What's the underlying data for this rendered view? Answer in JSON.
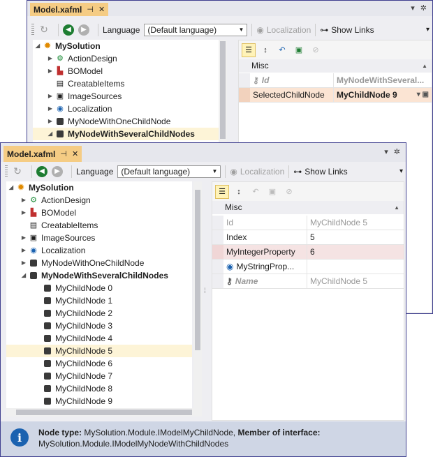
{
  "back_window": {
    "tab_title": "Model.xafml",
    "toolbar": {
      "language_label": "Language",
      "language_value": "(Default language)",
      "localization_label": "Localization",
      "show_links_label": "Show Links"
    },
    "tree": {
      "root": "MySolution",
      "items": [
        "ActionDesign",
        "BOModel",
        "CreatableItems",
        "ImageSources",
        "Localization",
        "MyNodeWithOneChildNode",
        "MyNodeWithSeveralChildNodes"
      ]
    },
    "grid": {
      "category": "Misc",
      "rows": [
        {
          "name": "Id",
          "value": "MyNodeWithSeveral..."
        },
        {
          "name": "SelectedChildNode",
          "value": "MyChildNode 9"
        }
      ]
    }
  },
  "front_window": {
    "tab_title": "Model.xafml",
    "toolbar": {
      "language_label": "Language",
      "language_value": "(Default language)",
      "localization_label": "Localization",
      "show_links_label": "Show Links"
    },
    "tree": {
      "root": "MySolution",
      "items": [
        "ActionDesign",
        "BOModel",
        "CreatableItems",
        "ImageSources",
        "Localization",
        "MyNodeWithOneChildNode",
        "MyNodeWithSeveralChildNodes"
      ],
      "children": [
        "MyChildNode 0",
        "MyChildNode 1",
        "MyChildNode 2",
        "MyChildNode 3",
        "MyChildNode 4",
        "MyChildNode 5",
        "MyChildNode 6",
        "MyChildNode 7",
        "MyChildNode 8",
        "MyChildNode 9"
      ]
    },
    "grid": {
      "category": "Misc",
      "rows": [
        {
          "name": "Id",
          "value": "MyChildNode 5"
        },
        {
          "name": "Index",
          "value": "5"
        },
        {
          "name": "MyIntegerProperty",
          "value": "6"
        },
        {
          "name": "MyStringProp...",
          "value": ""
        },
        {
          "name": "Name",
          "value": "MyChildNode 5"
        }
      ]
    },
    "status": {
      "node_type_label": "Node type:",
      "node_type_value": "MySolution.Module.IModelMyChildNode,",
      "member_label": "Member of interface:",
      "member_value": "MySolution.Module.IModelMyNodeWithChildNodes"
    }
  },
  "colors": {
    "accent_frame": "#3f3f8f",
    "tab_active": "#f5cc84",
    "selection": "#fdf4d7",
    "status_bg": "#cfd6e5",
    "info_blue": "#1b62b0"
  }
}
